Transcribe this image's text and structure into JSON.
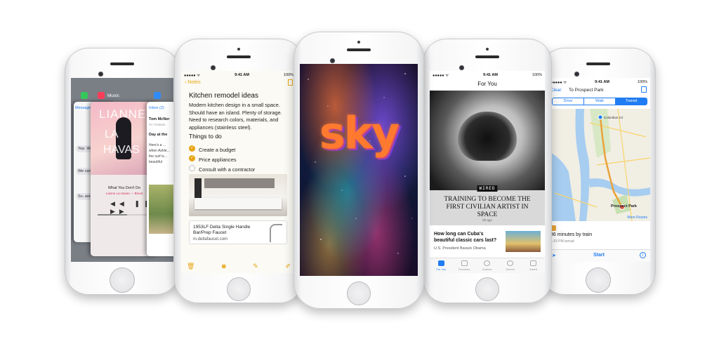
{
  "status": {
    "time": "9:41 AM",
    "battery": "100%"
  },
  "switcher": {
    "app_labels": [
      "Music",
      "Inbox (2)"
    ],
    "messages_back": "Messages",
    "music": {
      "album_art_text": [
        "LIANNE",
        "LA",
        "HAVAS"
      ],
      "song": "What You Don't Do",
      "artist": "Lianne La Havas — Blood"
    },
    "mail": {
      "inbox": "Inbox (2)",
      "sender": "Tom McNer",
      "to": "To: Graham",
      "subject": "Day at the",
      "snippet": "Here's a ... when Ashle... the surf is... beautiful"
    },
    "msg_snippets": [
      "Yep. We're",
      "We can",
      "So, are"
    ]
  },
  "notes": {
    "back": "Notes",
    "title": "Kitchen remodel ideas",
    "body": "Modern kitchen design in a small space. Should have an island. Plenty of storage. Need to research colors, materials, and appliances (stainless steel).",
    "subtitle": "Things to do",
    "todos": [
      {
        "text": "Create a budget",
        "done": true
      },
      {
        "text": "Price appliances",
        "done": true
      },
      {
        "text": "Consult with a contractor",
        "done": false
      }
    ],
    "link_title": "1953LF Delta Single Handle Bar/Prep Faucet",
    "link_url": "m.deltafaucet.com"
  },
  "sky": {
    "logo": "sky"
  },
  "news": {
    "title": "For You",
    "brand": "WIRED",
    "headline": "TRAINING TO BECOME THE FIRST CIVILIAN ARTIST IN SPACE",
    "age": "5h ago",
    "story_title": "How long can Cuba's beautiful classic cars last?",
    "story_sub": "U.S. President Barack Obama",
    "tabs": [
      "For You",
      "Favorites",
      "Explore",
      "Search",
      "Saved"
    ]
  },
  "maps": {
    "clear": "Clear",
    "to": "To Prospect Park",
    "modes": [
      "Drive",
      "Walk",
      "Transit"
    ],
    "active_mode": "Transit",
    "labels": [
      "Columbus Cir",
      "Prospect Park"
    ],
    "more_routes": "More Routes",
    "eta": "36 minutes by train",
    "eta_sub": "1:15 PM arrival",
    "start": "Start",
    "colors": {
      "accent": "#1f7cf2",
      "route": "#e8a33a"
    }
  }
}
